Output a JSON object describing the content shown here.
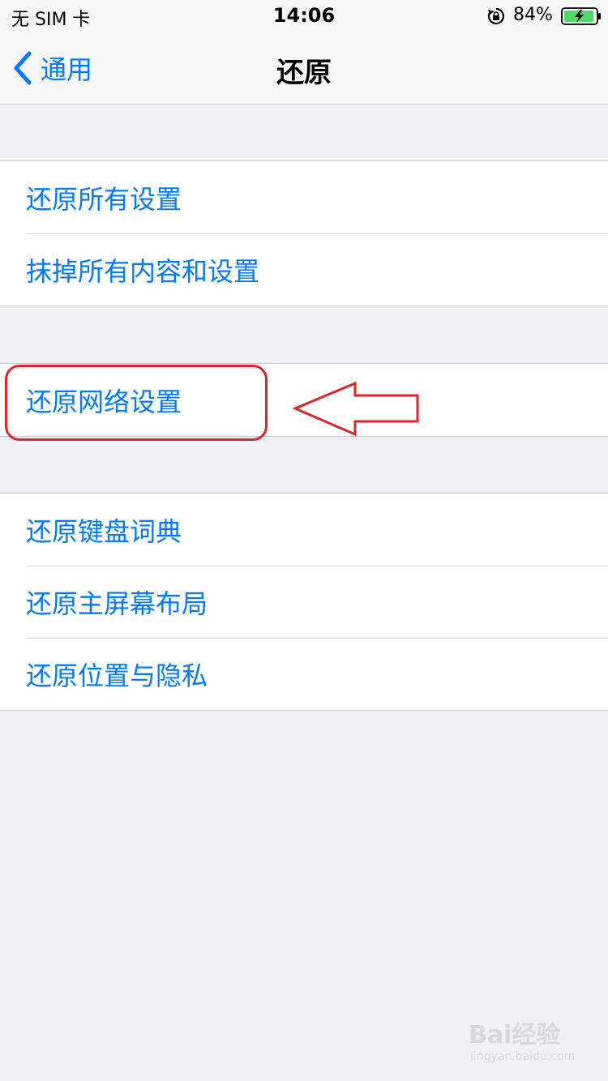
{
  "status_bar": {
    "carrier": "无 SIM 卡",
    "time": "14:06",
    "battery_percent": "84%",
    "icons": [
      "orientation-lock-icon",
      "battery-charging-icon"
    ]
  },
  "nav": {
    "back_label": "通用",
    "title": "还原"
  },
  "groups": [
    {
      "items": [
        {
          "label": "还原所有设置"
        },
        {
          "label": "抹掉所有内容和设置"
        }
      ]
    },
    {
      "items": [
        {
          "label": "还原网络设置"
        }
      ]
    },
    {
      "items": [
        {
          "label": "还原键盘词典"
        },
        {
          "label": "还原主屏幕布局"
        },
        {
          "label": "还原位置与隐私"
        }
      ]
    }
  ],
  "watermark": {
    "main": "Bai经验",
    "sub": "jingyan.baidu.com"
  },
  "colors": {
    "accent": "#007aff",
    "annotation": "#e1242b",
    "background": "#f0f0f5",
    "battery_fill": "#4cd964"
  }
}
